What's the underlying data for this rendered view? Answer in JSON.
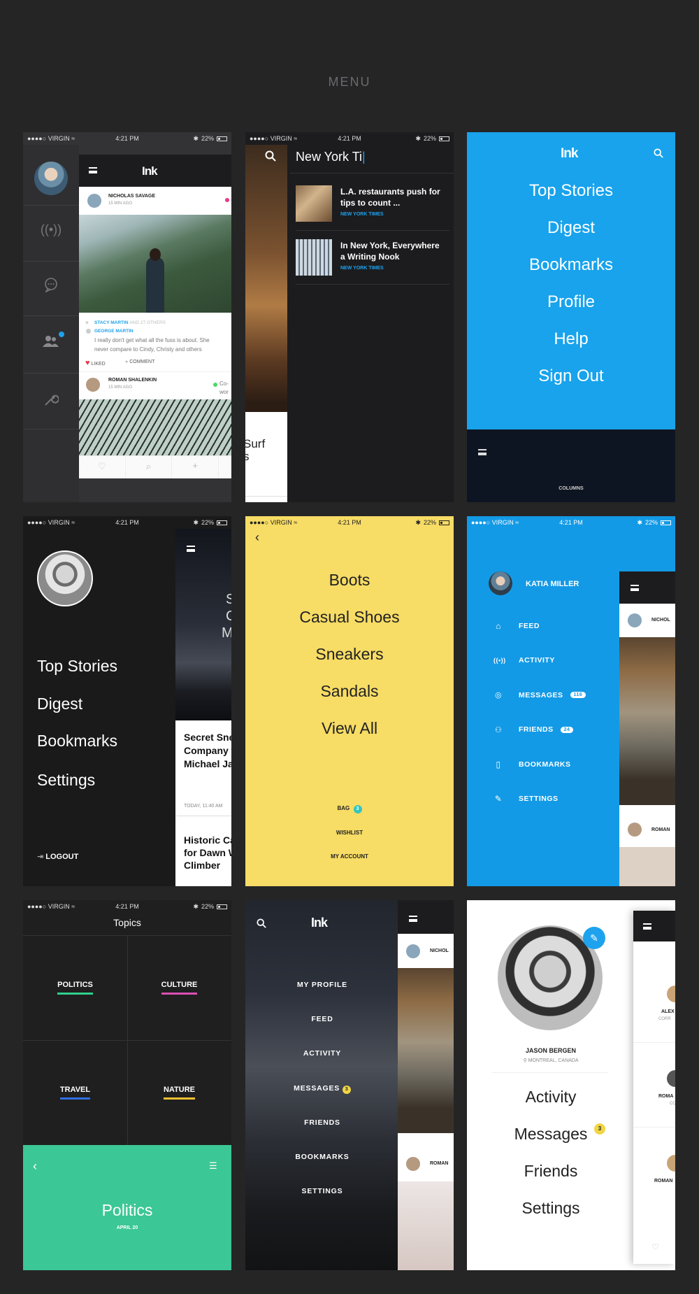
{
  "header": {
    "title": "MENU"
  },
  "status": {
    "carrier": "VIRGIN",
    "time": "4:21 PM",
    "battery": "22%"
  },
  "s1": {
    "app": "Ink",
    "card1": {
      "author": "NICHOLAS SAVAGE",
      "time": "15 MIN AGO"
    },
    "c1": {
      "name": "STACY MARTIN",
      "rest": "AND 27 OTHERS"
    },
    "c2": {
      "name": "GEORGE MARTIN",
      "text1": "I really don't get what all the fuss is about. She",
      "text2": "never compare to Cindy, Christy and others"
    },
    "liked": "LIKED",
    "comment": "COMMENT",
    "card2": {
      "author": "ROMAN SHALENKIN",
      "time": "15 MIN AGO",
      "aside1": "Co-",
      "aside2": "wor"
    }
  },
  "s2": {
    "query": "New York Ti",
    "r1": {
      "l1": "L.A. restaurants push for",
      "l2": "tips to count ...",
      "src": "NEW YORK TIMES"
    },
    "r2": {
      "l1": "In New York, Everywhere",
      "l2": "a Writing Nook",
      "src": "NEW YORK TIMES"
    },
    "peek": {
      "l1": "Surf",
      "l2": "s"
    }
  },
  "s3": {
    "app": "Ink",
    "items": [
      "Top Stories",
      "Digest",
      "Bookmarks",
      "Profile",
      "Help",
      "Sign Out"
    ],
    "footer": "COLUMNS"
  },
  "s4": {
    "items": [
      "Top Stories",
      "Digest",
      "Bookmarks",
      "Settings"
    ],
    "logout": "LOGOUT",
    "peek_chars": [
      "S",
      "C",
      "M"
    ],
    "h1": [
      "Secret Sne",
      "Company w",
      "Michael Ja"
    ],
    "date": "TODAY, 11:40 AM",
    "h2": [
      "Historic Ca",
      "for Dawn W",
      "Climber"
    ]
  },
  "s5": {
    "items": [
      "Boots",
      "Casual Shoes",
      "Sneakers",
      "Sandals",
      "View All"
    ],
    "bag": "BAG",
    "bag_count": "3",
    "wishlist": "WISHLIST",
    "account": "MY ACCOUNT"
  },
  "s6": {
    "user": "KATIA MILLER",
    "items": [
      {
        "label": "FEED",
        "badge": ""
      },
      {
        "label": "ACTIVITY",
        "badge": ""
      },
      {
        "label": "MESSAGES",
        "badge": "116"
      },
      {
        "label": "FRIENDS",
        "badge": "24"
      },
      {
        "label": "BOOKMARKS",
        "badge": ""
      },
      {
        "label": "SETTINGS",
        "badge": ""
      }
    ],
    "peek1": "NICHOL",
    "peek2": "ROMAN"
  },
  "s7": {
    "title": "Topics",
    "topics": [
      "POLITICS",
      "CULTURE",
      "TRAVEL",
      "NATURE"
    ],
    "colors": [
      "#2fd08a",
      "#d94fb3",
      "#2f6fe0",
      "#f0c030"
    ],
    "footer_title": "Politics",
    "footer_date": "APRIL 20"
  },
  "s8": {
    "app": "Ink",
    "items": [
      "MY PROFILE",
      "FEED",
      "ACTIVITY",
      "MESSAGES",
      "FRIENDS",
      "BOOKMARKS",
      "SETTINGS"
    ],
    "msg_badge": "3",
    "peek1": "NICHOL",
    "peek2": "ROMAN"
  },
  "s9": {
    "name": "JASON BERGEN",
    "location": "MONTREAL, CANADA",
    "items": [
      "Activity",
      "Messages",
      "Friends",
      "Settings"
    ],
    "msg_badge": "3",
    "peek": [
      {
        "n": "ALEX",
        "s": "CORR"
      },
      {
        "n": "ROMA",
        "s": "CC"
      },
      {
        "n": "ROMAN",
        "s": ""
      }
    ]
  }
}
